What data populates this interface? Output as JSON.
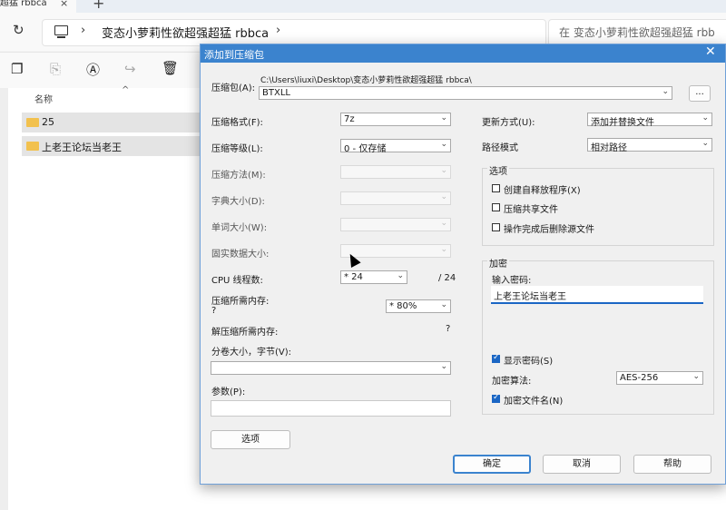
{
  "window": {
    "tab_title": "超猛 rbbca",
    "tab_close": "×",
    "new_tab": "+"
  },
  "address": {
    "breadcrumb": "变态小萝莉性欲超强超猛 rbbca",
    "search_placeholder": "在 变态小萝莉性欲超强超猛 rbb"
  },
  "files": {
    "column_name": "名称",
    "items": [
      {
        "name": "25"
      },
      {
        "name": "上老王论坛当老王"
      }
    ]
  },
  "dialog": {
    "title": "添加到压缩包",
    "close": "✕",
    "archive_label": "压缩包(A):",
    "archive_path": "C:\\Users\\liuxi\\Desktop\\变态小萝莉性欲超强超猛 rbbca\\",
    "archive_name": "BTXLL",
    "browse_label": "...",
    "format_label": "压缩格式(F):",
    "format_value": "7z",
    "level_label": "压缩等级(L):",
    "level_value": "0 - 仅存储",
    "method_label": "压缩方法(M):",
    "dict_label": "字典大小(D):",
    "word_label": "单词大小(W):",
    "solid_label": "固实数据大小:",
    "cpu_label": "CPU 线程数:",
    "cpu_value": "* 24",
    "cpu_total": "/ 24",
    "mem_label": "压缩所需内存:",
    "mem_value": "?",
    "mem_percent": "* 80%",
    "decomp_label": "解压缩所需内存:",
    "decomp_value": "?",
    "volume_label": "分卷大小，字节(V):",
    "volume_value": "",
    "params_label": "参数(P):",
    "params_value": "",
    "options_button": "选项",
    "update_label": "更新方式(U):",
    "update_value": "添加并替换文件",
    "path_label": "路径模式",
    "path_value": "相对路径",
    "options_group": "选项",
    "opt_sfx": "创建自释放程序(X)",
    "opt_shared": "压缩共享文件",
    "opt_delete": "操作完成后删除源文件",
    "encrypt_group": "加密",
    "password_label": "输入密码:",
    "password_value": "上老王论坛当老王",
    "show_password": "显示密码(S)",
    "algo_label": "加密算法:",
    "algo_value": "AES-256",
    "encrypt_names": "加密文件名(N)",
    "ok": "确定",
    "cancel": "取消",
    "help": "帮助"
  },
  "colors": {
    "title_bar": "#3b83ce",
    "accent": "#1a66c4",
    "folder": "#f2c14e"
  }
}
